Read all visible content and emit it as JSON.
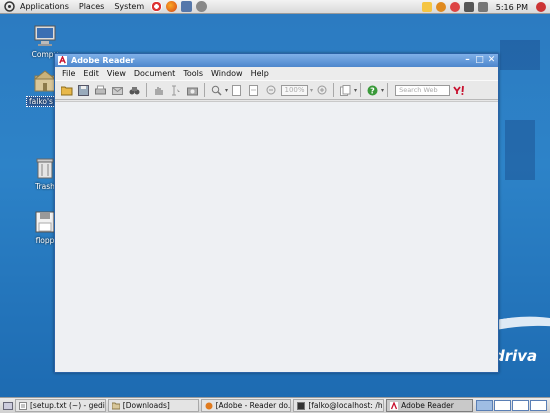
{
  "top_panel": {
    "menus": [
      "Applications",
      "Places",
      "System"
    ],
    "clock": "5:16 PM"
  },
  "desktop": {
    "icons": [
      {
        "label": "Compu"
      },
      {
        "label": "falko's H"
      },
      {
        "label": "Trash"
      },
      {
        "label": "flopp"
      }
    ],
    "brand": "driva"
  },
  "window": {
    "title": "Adobe Reader",
    "menus": [
      "File",
      "Edit",
      "View",
      "Document",
      "Tools",
      "Window",
      "Help"
    ],
    "zoom_value": "100%",
    "search_placeholder": "Search Web"
  },
  "taskbar": {
    "tasks": [
      {
        "label": "[setup.txt (~) - gedit]"
      },
      {
        "label": "[Downloads]"
      },
      {
        "label": "[Adobe - Reader do..."
      },
      {
        "label": "[falko@localhost: /h..."
      },
      {
        "label": "Adobe Reader"
      }
    ]
  },
  "colors": {
    "desktop_bg": "#2d83c8",
    "titlebar": "#4d86cc",
    "adobe_red": "#c8102e"
  }
}
